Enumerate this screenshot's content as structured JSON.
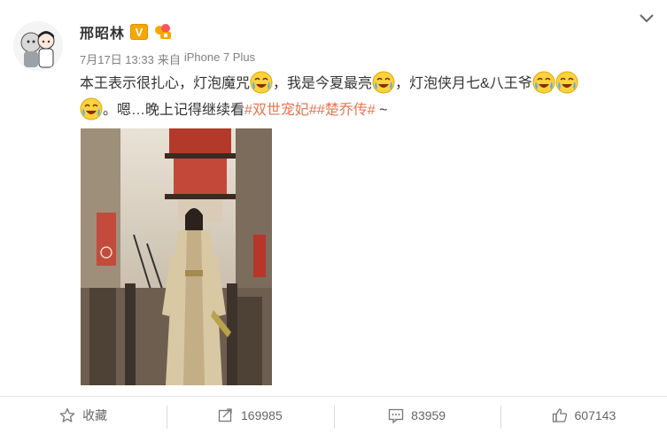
{
  "post": {
    "author": "邢昭林",
    "verified_badge": "V",
    "date": "7月17日 13:33",
    "source_prefix": "来自",
    "source": "iPhone 7 Plus",
    "text": {
      "p1": "本王表示很扎心，灯泡魔咒",
      "p2": "，我是今夏最亮",
      "p3": "，灯泡侠月七&八王爷",
      "p4": "。嗯…晚上记得继续看",
      "tag1": "#双世宠妃#",
      "tag2": "#楚乔传#",
      "p5": " ~"
    },
    "emoji_icons": [
      "laugh-cry-emoji",
      "laugh-cry-emoji",
      "laugh-cry-emoji",
      "laugh-cry-emoji",
      "laugh-cry-emoji"
    ]
  },
  "footer": {
    "favorite_label": "收藏",
    "repost_count": "169985",
    "comment_count": "83959",
    "like_count": "607143"
  },
  "colors": {
    "accent": "#eb7350",
    "vip": "#f7a800",
    "meta": "#808080"
  },
  "icons": [
    "chevron-down-icon",
    "star-icon",
    "repost-icon",
    "comment-icon",
    "like-icon"
  ]
}
